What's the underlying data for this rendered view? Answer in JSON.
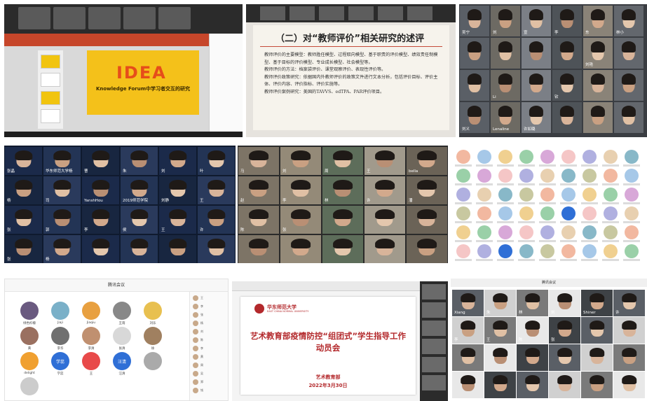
{
  "panel1": {
    "slide_logo": "IDEA",
    "slide_subtitle": "Knowledge Forum中学习者交互的研究"
  },
  "panel2": {
    "title": "（二）对“教师评价”相关研究的述评",
    "lines": [
      "教师评价的主要模型：教师胜任模型、过程取向模型、基于职责的评价模型、绩效责任制模型、基于目标的评价模型、专业成长模型、社会模型等。",
      "教师评价的方法：档案袋评价、课堂观察评价、表现性评价等。",
      "教师评价政策研究：依据国内外教师评价的政策文件进行文本分析，包括评价目标、评价主体、评价内容、评价指标、评价实施等。",
      "教师评价案例研究：美国的TAVVS、edTPA、PAR评价项目。"
    ]
  },
  "panel3": {
    "names": [
      "吴宁",
      "刘",
      "宣",
      "李",
      "东",
      "林小",
      "",
      "",
      "",
      "",
      "刘艳",
      "",
      "",
      "Li",
      "",
      "钦",
      "",
      "",
      "刘义",
      "Lenaline",
      "许如璐"
    ]
  },
  "panel4": {
    "names": [
      "张晶",
      "华东师范大学杨",
      "曹",
      "朱",
      "刘",
      "叶",
      "杨",
      "司",
      "YanshHou",
      "2019师范学院",
      "刘静",
      "王",
      "张",
      "郭",
      "李",
      "侯",
      "王",
      "许",
      "张",
      "杨"
    ]
  },
  "panel5": {
    "names": [
      "马",
      "刘",
      "周",
      "王",
      "bella",
      "赵",
      "李",
      "林",
      "许",
      "潘",
      "陈",
      "张"
    ]
  },
  "panel7": {
    "title": "腾讯会议",
    "names": [
      "绿色柠檬",
      "Jiaji",
      "Jiaqiu",
      "王雨",
      "刘乐",
      "黄",
      "李华",
      "李清",
      "张清",
      "徐",
      "delight",
      "学蕊",
      "王",
      "汪清",
      "",
      ""
    ],
    "badges": [
      "学蕊",
      "汪清"
    ],
    "member_list": [
      "王",
      "李",
      "张",
      "杨",
      "刘",
      "陈",
      "李",
      "黄",
      "周",
      "吴",
      "郑",
      "钱"
    ]
  },
  "panel8": {
    "school_name": "华东师范大学",
    "school_name_en": "EAST CHINA NORMAL UNIVERSITY",
    "title": "艺术教育部疫情防控“组团式”学生指导工作动员会",
    "department": "艺术教育部",
    "date": "2022年3月30日"
  },
  "panel9": {
    "title": "腾讯会议",
    "names": [
      "Xiang",
      "朱",
      "林",
      "刘",
      "Shiner",
      "许",
      "李",
      "王",
      "陈",
      "张"
    ]
  },
  "colors": {
    "slide_yellow": "#f4c11a",
    "idea_orange": "#e64d1a",
    "ecnu_red": "#b3292c",
    "zoom_dark": "#2b2b2b"
  }
}
